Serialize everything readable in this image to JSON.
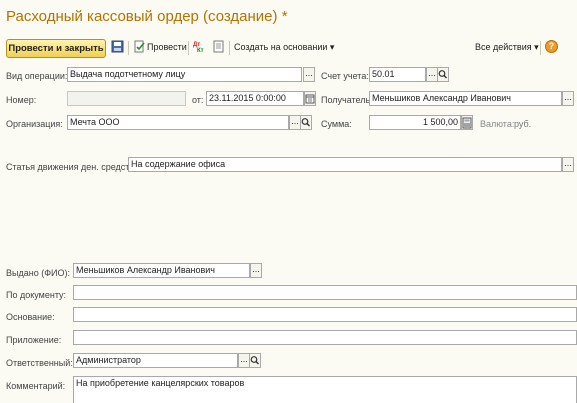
{
  "window": {
    "title": "Расходный кассовый ордер (создание) *"
  },
  "toolbar": {
    "post_close_label": "Провести и закрыть",
    "post_label": "Провести",
    "create_based_label": "Создать на основании",
    "all_actions_label": "Все действия",
    "help_label": "?"
  },
  "form": {
    "operation_type_label": "Вид операции:",
    "operation_type_value": "Выдача подотчетному лицу",
    "account_label": "Счет учета:",
    "account_value": "50.01",
    "number_label": "Номер:",
    "number_value": "",
    "date_label": "от:",
    "date_value": "23.11.2015  0:00:00",
    "recipient_label": "Получатель:",
    "recipient_value": "Меньшиков Александр Иванович",
    "organization_label": "Организация:",
    "organization_value": "Мечта ООО",
    "sum_label": "Сумма:",
    "sum_value": "1 500,00",
    "currency_label": "Валюта:",
    "currency_value": "руб.",
    "cash_flow_label": "Статья движения ден. средств:",
    "cash_flow_value": "На содержание офиса",
    "issued_label": "Выдано (ФИО):",
    "issued_value": "Меньшиков Александр Иванович",
    "by_document_label": "По документу:",
    "by_document_value": "",
    "basis_label": "Основание:",
    "basis_value": "",
    "attachment_label": "Приложение:",
    "attachment_value": "",
    "responsible_label": "Ответственный:",
    "responsible_value": "Администратор",
    "comment_label": "Комментарий:",
    "comment_value": "На приобретение канцелярских товаров"
  },
  "colors": {
    "title": "#b07400",
    "accent_button": "#f2cf52"
  }
}
